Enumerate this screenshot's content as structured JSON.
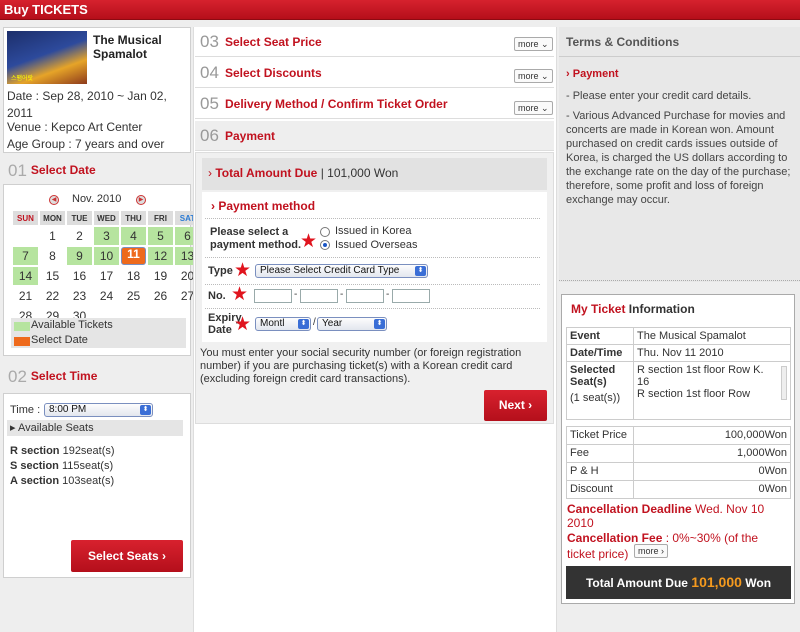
{
  "header": {
    "title": "Buy TICKETS"
  },
  "show": {
    "poster_text": "스팸어랏",
    "title": "The Musical Spamalot",
    "date": "Date : Sep 28, 2010 ~ Jan 02, 2011",
    "venue": "Venue : Kepco Art Center",
    "age": "Age Group : 7 years and over"
  },
  "select_date": {
    "num": "01",
    "label": "Select Date",
    "month": "Nov. 2010",
    "weekdays": [
      "SUN",
      "MON",
      "TUE",
      "WED",
      "THU",
      "FRI",
      "SAT"
    ],
    "weeks": [
      [
        "",
        "1",
        "2",
        "3",
        "4",
        "5",
        "6"
      ],
      [
        "7",
        "8",
        "9",
        "10",
        "11",
        "12",
        "13"
      ],
      [
        "14",
        "15",
        "16",
        "17",
        "18",
        "19",
        "20"
      ],
      [
        "21",
        "22",
        "23",
        "24",
        "25",
        "26",
        "27"
      ],
      [
        "28",
        "29",
        "30",
        "",
        "",
        "",
        ""
      ]
    ],
    "available": [
      "3",
      "4",
      "5",
      "6",
      "7",
      "9",
      "10",
      "12",
      "13",
      "14"
    ],
    "selected": "11",
    "legend_available": "Available Tickets",
    "legend_selected": "Select Date",
    "colors": {
      "available": "#b6e49f",
      "selected": "#ee6a1c"
    }
  },
  "select_time": {
    "num": "02",
    "label": "Select Time",
    "time_label": "Time :",
    "time_value": "8:00 PM",
    "available_label": "Available Seats",
    "sections": [
      {
        "name": "R section",
        "seats": "192seat(s)"
      },
      {
        "name": "S section",
        "seats": "115seat(s)"
      },
      {
        "name": "A section",
        "seats": "103seat(s)"
      }
    ],
    "button": "Select Seats"
  },
  "steps": [
    {
      "num": "03",
      "label": "Select Seat Price",
      "more": "more"
    },
    {
      "num": "04",
      "label": "Select Discounts",
      "more": "more"
    },
    {
      "num": "05",
      "label": "Delivery Method / Confirm Ticket Order",
      "more": "more"
    },
    {
      "num": "06",
      "label": "Payment"
    }
  ],
  "payment": {
    "total_label": "Total Amount Due",
    "total_value": "| 101,000 Won",
    "method_title": "Payment method",
    "prompt": "Please select a payment method.",
    "opt1": "Issued in Korea",
    "opt2": "Issued Overseas",
    "type_label": "Type",
    "type_value": "Please Select Credit Card Type",
    "no_label": "No.",
    "expiry_label": "Expiry Date",
    "month_value": "Montl",
    "year_value": "Year",
    "note": "You must enter your social security number (or foreign registration number) if you are purchasing ticket(s) with a Korean credit card (excluding foreign credit card transactions).",
    "next": "Next"
  },
  "terms": {
    "title": "Terms & Conditions",
    "payment_heading": "Payment",
    "line1": "- Please enter your credit card details.",
    "line2": "- Various Advanced Purchase for movies and concerts are made in Korean won. Amount purchased on credit cards issues outside of Korea, is charged the US dollars according to the exchange rate on the day of the purchase; therefore, some profit and loss of foreign exchange may occur."
  },
  "my_ticket": {
    "title_red": "My Ticket",
    "title_rest": " Information",
    "event_k": "Event",
    "event_v": "The Musical Spamalot",
    "dt_k": "Date/Time",
    "dt_v": "Thu. Nov 11 2010",
    "seat_k": "Selected Seat(s)",
    "seat_count": "(1 seat(s))",
    "seat_v": "R section 1st floor Row K. 16",
    "seat_v2": "R section 1st floor Row",
    "prices": [
      {
        "k": "Ticket Price",
        "v": "100,000Won"
      },
      {
        "k": "Fee",
        "v": "1,000Won"
      },
      {
        "k": "P & H",
        "v": "0Won"
      },
      {
        "k": "Discount",
        "v": "0Won"
      }
    ],
    "deadline_k": "Cancellation Deadline",
    "deadline_v": "Wed. Nov 10 2010",
    "fee_k": "Cancellation Fee",
    "fee_v": ": 0%~30% (of the ticket price)",
    "more": "more",
    "total_label": "Total Amount Due",
    "total_value": "101,000",
    "total_unit": "Won"
  }
}
